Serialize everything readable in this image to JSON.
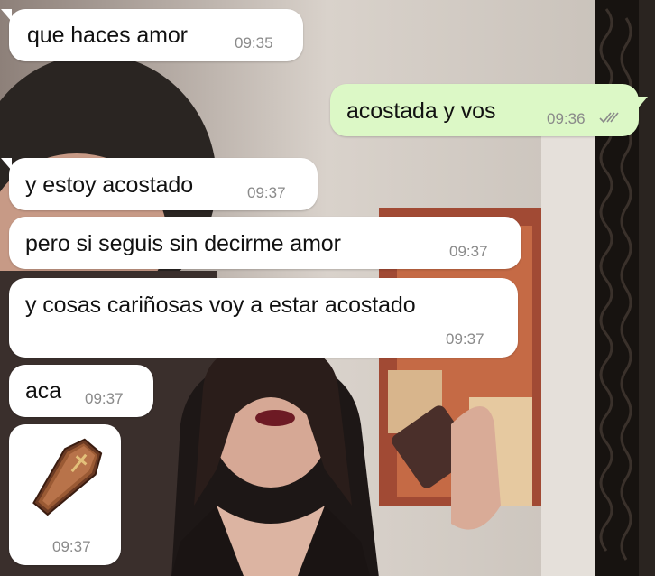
{
  "conversation": {
    "messages": [
      {
        "id": "m1",
        "direction": "incoming",
        "text": "que haces amor",
        "time": "09:35"
      },
      {
        "id": "m2",
        "direction": "outgoing",
        "text": "acostada y vos",
        "time": "09:36",
        "status": "read"
      },
      {
        "id": "m3",
        "direction": "incoming",
        "text": "y estoy acostado",
        "time": "09:37"
      },
      {
        "id": "m4",
        "direction": "incoming",
        "text": "pero si seguis sin decirme amor",
        "time": "09:37"
      },
      {
        "id": "m5",
        "direction": "incoming",
        "text": "y cosas cariñosas voy a estar acostado",
        "time": "09:37"
      },
      {
        "id": "m6",
        "direction": "incoming",
        "text": "aca",
        "time": "09:37"
      },
      {
        "id": "m7",
        "direction": "incoming",
        "sticker": "coffin-icon",
        "time": "09:37"
      }
    ]
  },
  "colors": {
    "incoming_bubble": "#ffffff",
    "outgoing_bubble": "#dcf8c6",
    "timestamp": "#8a8a8a",
    "read_ticks": "#8a8a8a"
  }
}
